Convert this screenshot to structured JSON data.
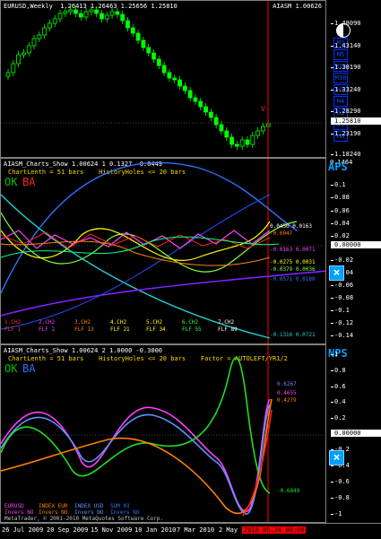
{
  "main": {
    "title": "EURUSD,Weekly  1.26413 1.26463 1.25656 1.25810",
    "indicator": "AIASM 1.00626",
    "price_ticks": [
      "1.48090",
      "1.43140",
      "1.38190",
      "1.33240",
      "1.28290",
      "1.23190",
      "1.18240"
    ],
    "current_price": "1.25810",
    "marker_v": "V",
    "timeframes": [
      "M1",
      "M5",
      "M15",
      "M30",
      "H1",
      "H4",
      "D1",
      "W1",
      "MN"
    ]
  },
  "aps": {
    "title": "AIASM_Charts_Show 1.00624 1 0.1327 -0.0449",
    "params": "ChartLenth = 51 bars    HistoryHoles <= 20 bars",
    "ok": "OK",
    "ba": "BA",
    "badge": "APS",
    "top_value": "0.1464",
    "ticks": [
      "0.1",
      "0.08",
      "0.06",
      "0.04",
      "0.02",
      "0.00000",
      "-0.02",
      "-0.04",
      "-0.06",
      "-0.08",
      "-0.1",
      "-0.12",
      "-0.14"
    ],
    "line_values": [
      "0.0450 0.0163",
      "-0.0047",
      "-0.0163 0.0071",
      "-0.0275 0.0031",
      "-0.0379 0.0036",
      "-0.0571 0.0180",
      "-0.1316 0.0721"
    ],
    "legend": [
      {
        "ch": "1.CH2",
        "flf": "FLF 1",
        "color": "#ff3030"
      },
      {
        "ch": "2.CH2",
        "flf": "FLF 2",
        "color": "#ff40ff"
      },
      {
        "ch": "3.CH2",
        "flf": "FLF 13",
        "color": "#ff8000"
      },
      {
        "ch": "4.CH2",
        "flf": "FLF 21",
        "color": "#ffff00"
      },
      {
        "ch": "5.CH2",
        "flf": "FLF 34",
        "color": "#ffff00"
      },
      {
        "ch": "6.CH2",
        "flf": "FLF 55",
        "color": "#40ff40"
      },
      {
        "ch": "7.CH2",
        "flf": "FLF 89",
        "color": "#ffffff"
      }
    ]
  },
  "nps": {
    "title": "AIASM_Charts_Show 1.00624 2 1.0000 -0.3000",
    "params": "ChartLenth = 51 bars    HistoryHoles <= 20 bars    Factor = AUTOLEFT/YR1/2",
    "ok": "OK",
    "ba": "BA",
    "badge": "NPS",
    "ticks": [
      "1",
      "0.8",
      "0.6",
      "0.4",
      "0.2",
      "0.00000",
      "-0.2",
      "-0.4",
      "-0.6",
      "-0.8",
      "-1"
    ],
    "values": [
      "0.6267",
      "0.4655",
      "0.4279",
      "-0.6849"
    ],
    "rows": [
      [
        "EURUSD",
        "INDEX EUR",
        "INDEX USD",
        "SUM 03"
      ],
      [
        "Invers NO",
        "Invers NO",
        "Invers NO",
        "Invers NO"
      ]
    ],
    "copyright": "MetaTrader, © 2001-2010 MetaQuotes Software Corp."
  },
  "xaxis": [
    "26 Jul 2009",
    "20 Sep 2009",
    "15 Nov 2009",
    "10 Jan 2010",
    "7 Mar 2010",
    "2 May 2"
  ],
  "xaxis_current": "2010.05.24 00:00"
}
